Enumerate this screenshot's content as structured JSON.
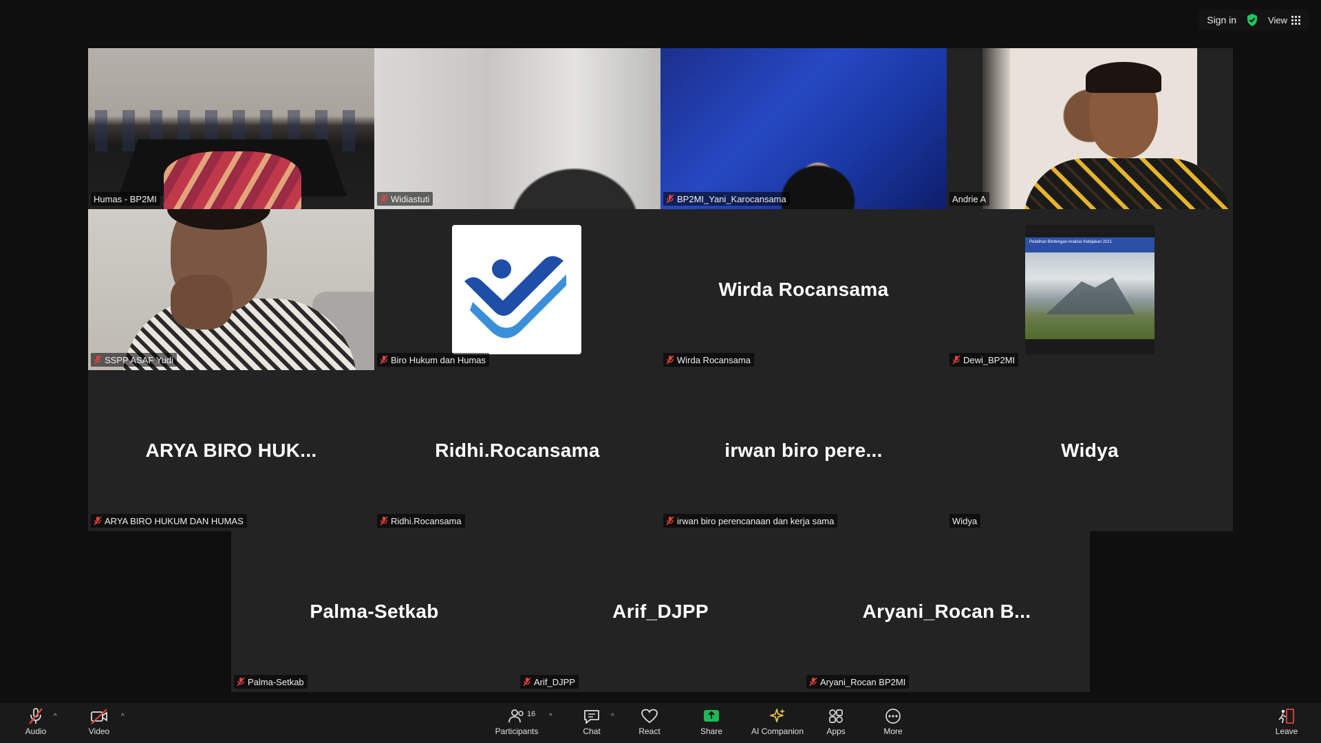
{
  "topbar": {
    "sign_in": "Sign in",
    "view": "View"
  },
  "tiles": {
    "t1": {
      "label": "Humas - BP2MI"
    },
    "t2": {
      "label": "Widiastuti"
    },
    "t3": {
      "label": "BP2MI_Yani_Karocansama"
    },
    "t4": {
      "label": "Andrie A"
    },
    "t5": {
      "label": "SSPP ASAF Yudi"
    },
    "t6": {
      "label": "Biro Hukum dan Humas"
    },
    "t7": {
      "center": "Wirda Rocansama",
      "label": "Wirda Rocansama"
    },
    "t8": {
      "label": "Dewi_BP2MI",
      "banner": "Pelatihan Bimbingan Analisis Kebijakan 2021"
    },
    "t9": {
      "center": "ARYA BIRO HUK...",
      "label": "ARYA BIRO HUKUM DAN HUMAS"
    },
    "t10": {
      "center": "Ridhi.Rocansama",
      "label": "Ridhi.Rocansama"
    },
    "t11": {
      "center": "irwan biro pere...",
      "label": "irwan biro perencanaan dan kerja sama"
    },
    "t12": {
      "center": "Widya",
      "label": "Widya"
    },
    "t13": {
      "center": "Palma-Setkab",
      "label": "Palma-Setkab"
    },
    "t14": {
      "center": "Arif_DJPP",
      "label": "Arif_DJPP"
    },
    "t15": {
      "center": "Aryani_Rocan  B...",
      "label": "Aryani_Rocan BP2MI"
    }
  },
  "toolbar": {
    "audio": "Audio",
    "video": "Video",
    "participants": "Participants",
    "participant_count": "16",
    "chat": "Chat",
    "react": "React",
    "share": "Share",
    "ai_companion": "AI Companion",
    "apps": "Apps",
    "more": "More",
    "leave": "Leave"
  },
  "icons": {
    "audio": "mic-off-icon",
    "video": "video-off-icon",
    "participants": "people-icon",
    "chat": "chat-icon",
    "react": "heart-icon",
    "share": "share-screen-icon",
    "ai_companion": "sparkle-icon",
    "apps": "apps-icon",
    "more": "more-icon",
    "leave": "leave-icon"
  },
  "colors": {
    "active_speaker": "#2fd36b",
    "share_green": "#1db954",
    "muted_red": "#e0443e",
    "tile_bg": "#232323"
  }
}
